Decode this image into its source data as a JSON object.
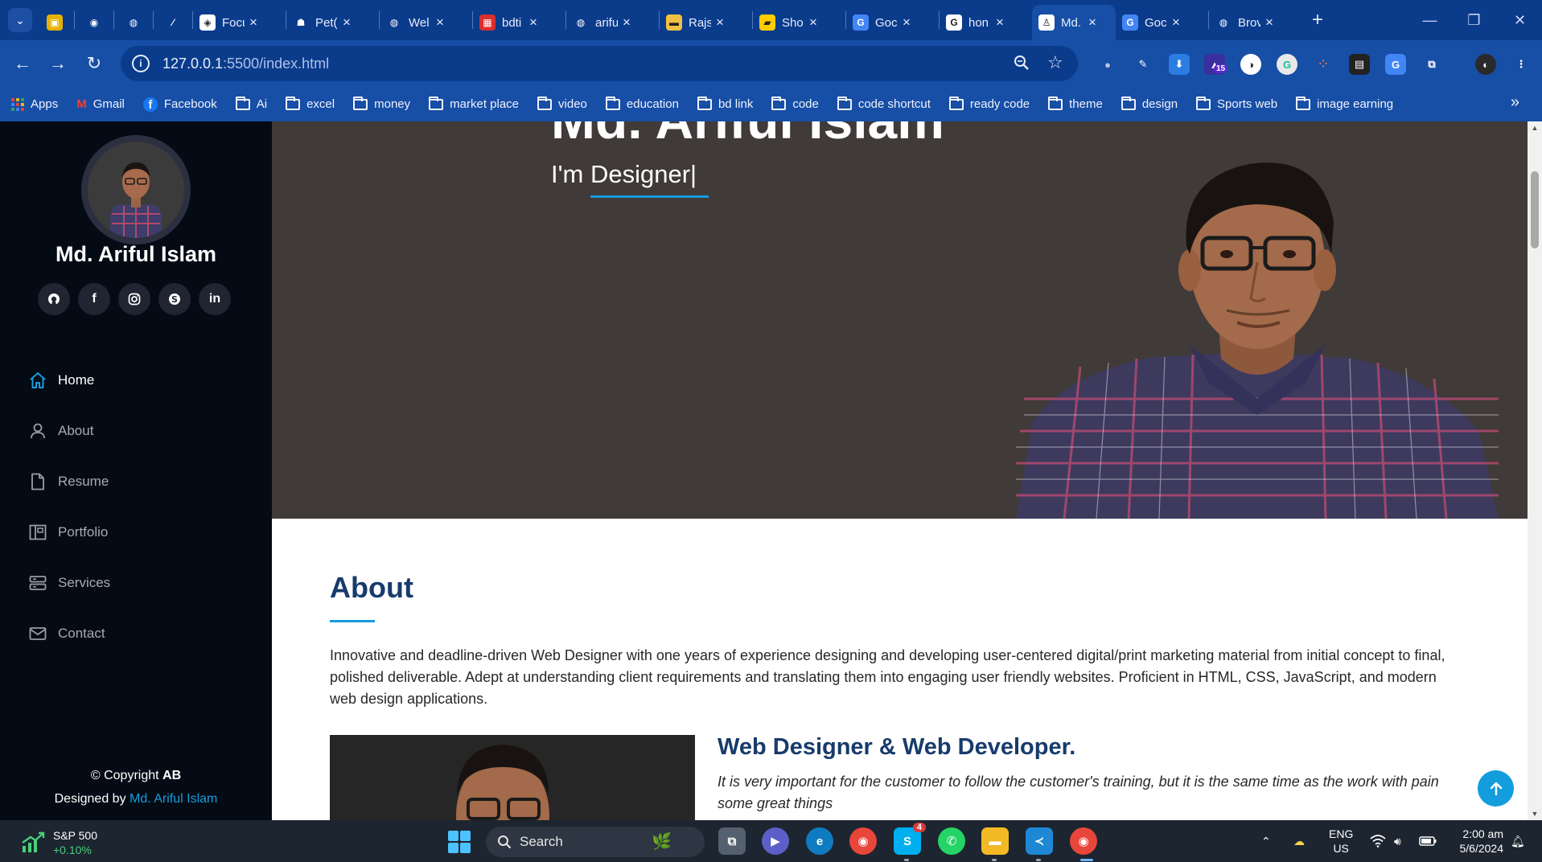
{
  "browser": {
    "tabs": [
      {
        "title": "",
        "kind": "pinned",
        "fav_bg": "#e7b100",
        "fav_glyph": "▣"
      },
      {
        "title": "",
        "kind": "pinned",
        "fav_bg": "transparent",
        "fav_glyph": "◉"
      },
      {
        "title": "",
        "kind": "pinned",
        "fav_bg": "transparent",
        "fav_glyph": "◍"
      },
      {
        "title": "",
        "kind": "pinned",
        "fav_bg": "transparent",
        "fav_glyph": "⁄"
      },
      {
        "title": "Focu",
        "kind": "normal",
        "fav_bg": "#ffffff",
        "fav_glyph": "◈"
      },
      {
        "title": "Pet(",
        "kind": "normal",
        "fav_bg": "transparent",
        "fav_glyph": "☗"
      },
      {
        "title": "Wel",
        "kind": "normal",
        "fav_bg": "transparent",
        "fav_glyph": "◍"
      },
      {
        "title": "bdti",
        "kind": "normal",
        "fav_bg": "#d92f2f",
        "fav_glyph": "▦"
      },
      {
        "title": "arifu",
        "kind": "normal",
        "fav_bg": "transparent",
        "fav_glyph": "◍"
      },
      {
        "title": "Rajs",
        "kind": "normal",
        "fav_bg": "#f0c040",
        "fav_glyph": "▬"
      },
      {
        "title": "Sho",
        "kind": "normal",
        "fav_bg": "#ffcc00",
        "fav_glyph": "▰"
      },
      {
        "title": "Goc",
        "kind": "normal",
        "fav_bg": "#4285f4",
        "fav_glyph": "G"
      },
      {
        "title": "hon",
        "kind": "normal",
        "fav_bg": "#ffffff",
        "fav_glyph": "G"
      },
      {
        "title": "Md.",
        "kind": "active",
        "fav_bg": "#ffffff",
        "fav_glyph": "♙"
      },
      {
        "title": "Goc",
        "kind": "normal",
        "fav_bg": "#4285f4",
        "fav_glyph": "G"
      },
      {
        "title": "Brov",
        "kind": "normal",
        "fav_bg": "transparent",
        "fav_glyph": "◍"
      }
    ],
    "url_host": "127.0.0.1",
    "url_rest": ":5500/index.html",
    "bookmarks": [
      {
        "label": "Apps",
        "icon": "apps"
      },
      {
        "label": "Gmail",
        "icon": "gmail"
      },
      {
        "label": "Facebook",
        "icon": "facebook"
      },
      {
        "label": "Ai",
        "icon": "folder"
      },
      {
        "label": "excel",
        "icon": "folder"
      },
      {
        "label": "money",
        "icon": "folder"
      },
      {
        "label": "market place",
        "icon": "folder"
      },
      {
        "label": "video",
        "icon": "folder"
      },
      {
        "label": "education",
        "icon": "folder"
      },
      {
        "label": "bd link",
        "icon": "folder"
      },
      {
        "label": "code",
        "icon": "folder"
      },
      {
        "label": "code shortcut",
        "icon": "folder"
      },
      {
        "label": "ready code",
        "icon": "folder"
      },
      {
        "label": "theme",
        "icon": "folder"
      },
      {
        "label": "design",
        "icon": "folder"
      },
      {
        "label": "Sports web",
        "icon": "folder"
      },
      {
        "label": "image earning",
        "icon": "folder"
      }
    ],
    "extension_badge": "15"
  },
  "sidebar": {
    "name": "Md. Ariful Islam",
    "socials": [
      "github",
      "facebook",
      "instagram",
      "skype",
      "linkedin"
    ],
    "nav": [
      {
        "label": "Home",
        "icon": "home-icon",
        "active": true
      },
      {
        "label": "About",
        "icon": "user-icon",
        "active": false
      },
      {
        "label": "Resume",
        "icon": "file-icon",
        "active": false
      },
      {
        "label": "Portfolio",
        "icon": "portfolio-icon",
        "active": false
      },
      {
        "label": "Services",
        "icon": "server-icon",
        "active": false
      },
      {
        "label": "Contact",
        "icon": "mail-icon",
        "active": false
      }
    ],
    "copyright_prefix": "© Copyright ",
    "copyright_owner": "AB",
    "designed_by": "Designed by ",
    "designer": "Md. Ariful Islam"
  },
  "hero": {
    "title": "Md. Ariful Islam",
    "subtitle": "I'm Designer|"
  },
  "about": {
    "heading": "About",
    "paragraph": "Innovative and deadline-driven Web Designer with one years of experience designing and developing user-centered digital/print marketing material from initial concept to final, polished deliverable. Adept at understanding client requirements and translating them into engaging user friendly websites. Proficient in HTML, CSS, JavaScript, and modern web design applications.",
    "role": "Web Designer & Web Developer.",
    "quote": "It is very important for the customer to follow the customer's training, but it is the same time as the work with pain some great things"
  },
  "taskbar": {
    "stock_name": "S&P 500",
    "stock_change": "+0.10%",
    "search_label": "Search",
    "skype_badge": "4",
    "lang_top": "ENG",
    "lang_bottom": "US",
    "time": "2:00 am",
    "date": "5/6/2024"
  },
  "colors": {
    "accent": "#149ddd",
    "heading": "#173b6c",
    "sidebar_bg": "#040b14",
    "hero_bg": "#403a39"
  }
}
